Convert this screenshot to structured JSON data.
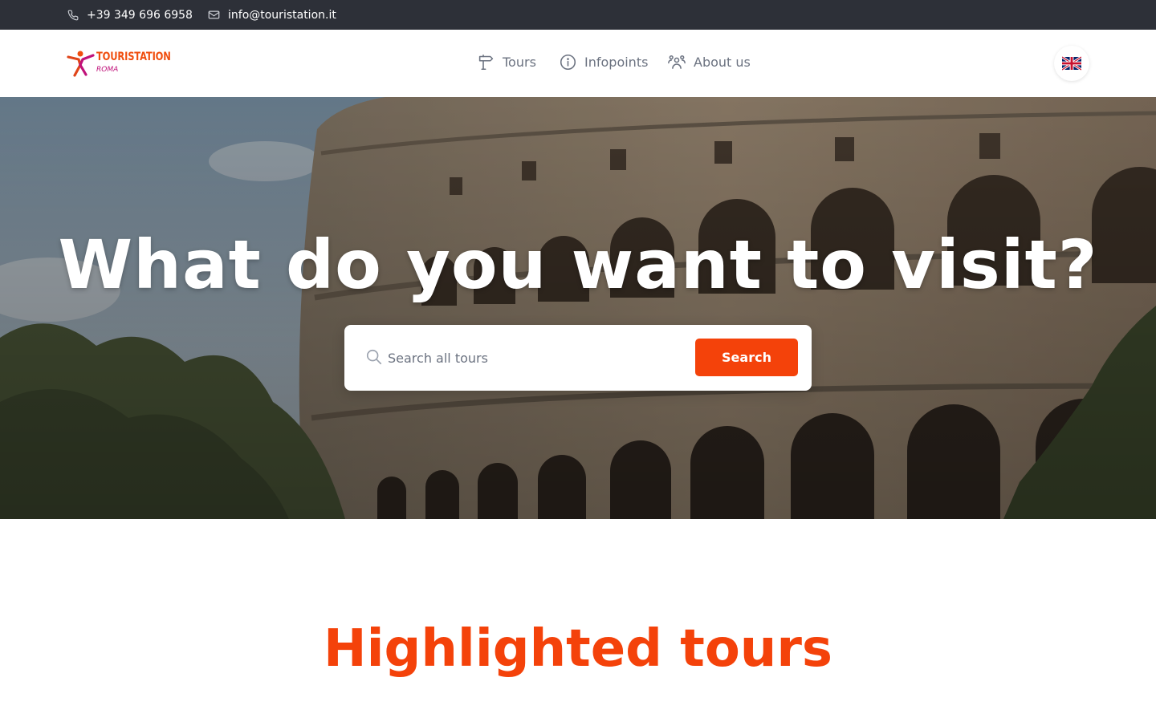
{
  "topbar": {
    "phone": "+39 349 696 6958",
    "email": "info@touristation.it",
    "phone_icon": "phone-icon",
    "email_icon": "mail-icon"
  },
  "header": {
    "logo_title": "TOURISTATION",
    "logo_subtitle": "ROMA",
    "nav": [
      {
        "label": "Tours",
        "icon": "signpost-icon"
      },
      {
        "label": "Infopoints",
        "icon": "info-icon"
      },
      {
        "label": "About us",
        "icon": "users-icon"
      }
    ],
    "language_icon": "uk-flag-icon"
  },
  "hero": {
    "title": "What do you want to visit?",
    "background": "colosseum-photo",
    "search_placeholder": "Search all tours",
    "search_value": "",
    "search_button": "Search"
  },
  "highlighted": {
    "title": "Highlighted tours"
  },
  "colors": {
    "accent": "#f4420a",
    "topbar_bg": "#2d3038",
    "nav_text": "#6b7280",
    "logo_orange": "#f04e0e",
    "logo_magenta": "#c0127a"
  }
}
